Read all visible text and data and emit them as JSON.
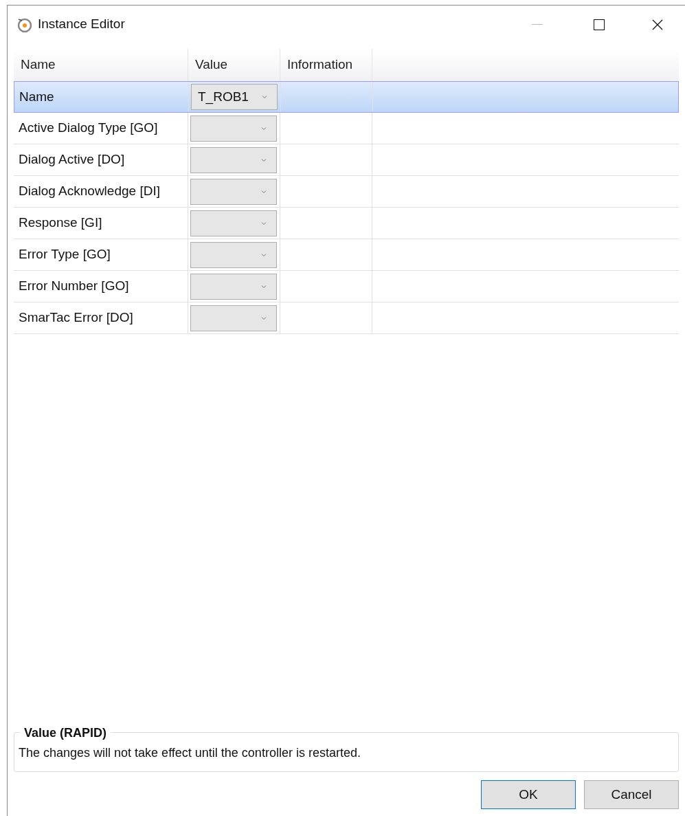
{
  "window": {
    "title": "Instance Editor"
  },
  "table": {
    "columns": [
      "Name",
      "Value",
      "Information"
    ],
    "rows": [
      {
        "name": "Name",
        "value": "T_ROB1",
        "selected": true
      },
      {
        "name": "Active Dialog Type [GO]",
        "selected": false
      },
      {
        "name": "Dialog Active [DO]",
        "selected": false
      },
      {
        "name": "Dialog Acknowledge [DI]",
        "selected": false
      },
      {
        "name": "Response [GI]",
        "selected": false
      },
      {
        "name": "Error Type [GO]",
        "selected": false
      },
      {
        "name": "Error Number [GO]",
        "selected": false
      },
      {
        "name": "SmarTac Error [DO]",
        "selected": false
      }
    ]
  },
  "info": {
    "title": "Value (RAPID)",
    "text": "The changes will not take effect until the controller is restarted."
  },
  "buttons": [
    {
      "label": "OK",
      "default": true
    },
    {
      "label": "Cancel",
      "default": false
    }
  ]
}
